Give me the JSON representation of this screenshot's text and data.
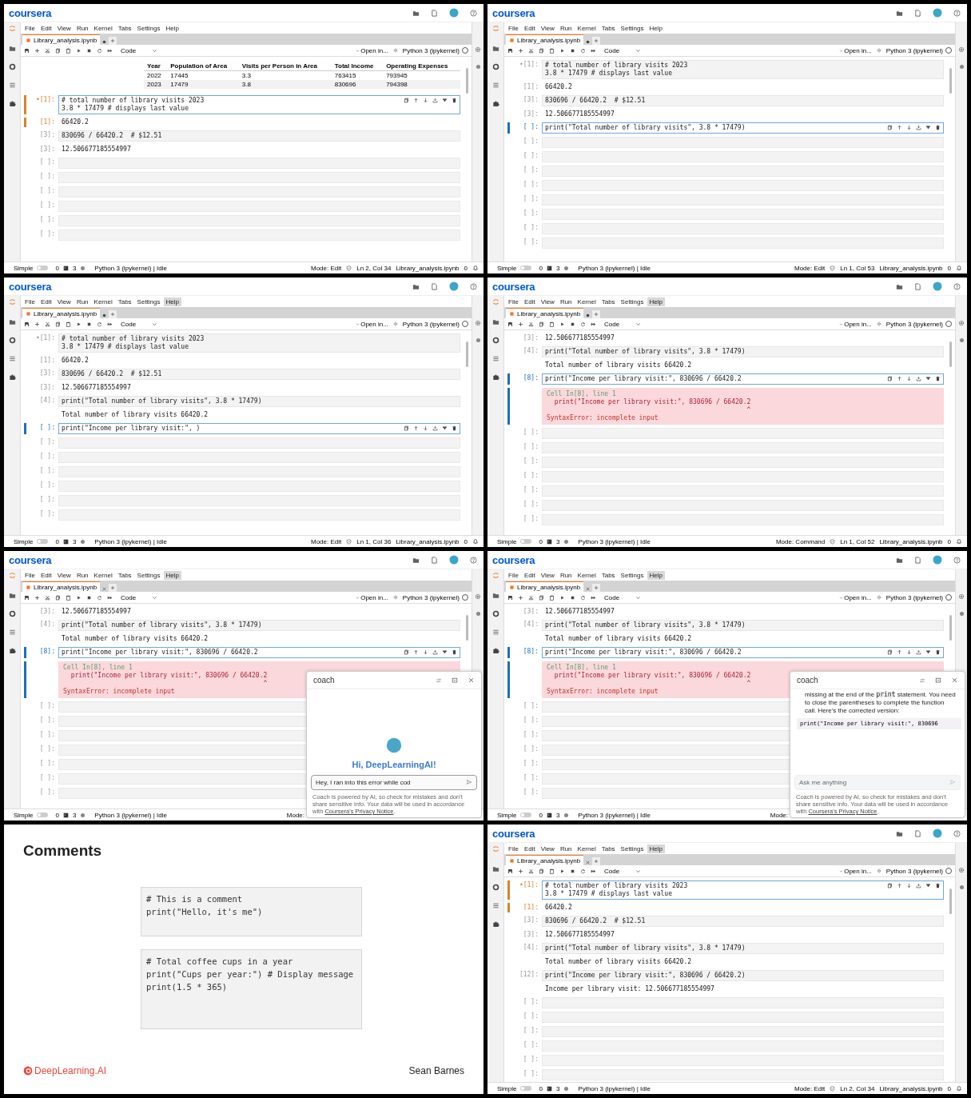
{
  "panels": [
    {
      "kind": "notebook",
      "brand": "coursera",
      "menu": [
        {
          "label": "File",
          "selected": false
        },
        {
          "label": "Edit",
          "selected": false
        },
        {
          "label": "View",
          "selected": false
        },
        {
          "label": "Run",
          "selected": false
        },
        {
          "label": "Kernel",
          "selected": false
        },
        {
          "label": "Tabs",
          "selected": false
        },
        {
          "label": "Settings",
          "selected": false
        },
        {
          "label": "Help",
          "selected": false
        }
      ],
      "tab": {
        "title": "Library_analysis.ipynb",
        "modified": true
      },
      "toolbar": {
        "cell_type": "Code",
        "open_in": "Open in...",
        "kernel": "Python 3 (ipykernel)"
      },
      "cells": [
        {
          "kind": "table",
          "selected": false,
          "columns": [
            "Year",
            "Population of Area",
            "Visits per Person in Area",
            "Total Income",
            "Operating Expenses"
          ],
          "rows": [
            [
              "2022",
              "17445",
              "3.3",
              "763415",
              "793945"
            ],
            [
              "2023",
              "17479",
              "3.8",
              "830696",
              "794398"
            ]
          ]
        },
        {
          "kind": "code",
          "prompt": "•[1]:",
          "text": "# total number of library visits 2023\n3.8 * 17479 # displays last value",
          "selected": true,
          "color": "#d9822b"
        },
        {
          "kind": "output",
          "prompt": "[1]:",
          "text": "66420.2",
          "selected": false,
          "color": "#d9822b"
        },
        {
          "kind": "code",
          "prompt": "[3]:",
          "text": "830696 / 66420.2  # $12.51",
          "selected": false
        },
        {
          "kind": "output",
          "prompt": "[3]:",
          "text": "12.506677185554997",
          "selected": false
        },
        {
          "kind": "empty",
          "prompt": "[ ]:",
          "selected": false
        },
        {
          "kind": "empty",
          "prompt": "[ ]:",
          "selected": false
        },
        {
          "kind": "empty",
          "prompt": "[ ]:",
          "selected": false
        },
        {
          "kind": "empty",
          "prompt": "[ ]:",
          "selected": false
        },
        {
          "kind": "empty",
          "prompt": "[ ]:",
          "selected": false
        },
        {
          "kind": "empty",
          "prompt": "[ ]:",
          "selected": false
        }
      ],
      "status": {
        "toggle": "Simple",
        "toggle_on": false,
        "terminals": "0",
        "kernels": "3",
        "kernel_status": "Python 3 (ipykernel) | Idle",
        "mode": "Mode: Edit",
        "position": "Ln 2, Col 34",
        "file": "Library_analysis.ipynb",
        "notifications": "0"
      }
    },
    {
      "kind": "notebook",
      "brand": "coursera",
      "menu": [
        {
          "label": "File",
          "selected": false
        },
        {
          "label": "Edit",
          "selected": false
        },
        {
          "label": "View",
          "selected": false
        },
        {
          "label": "Run",
          "selected": false
        },
        {
          "label": "Kernel",
          "selected": false
        },
        {
          "label": "Tabs",
          "selected": false
        },
        {
          "label": "Settings",
          "selected": false
        },
        {
          "label": "Help",
          "selected": false
        }
      ],
      "tab": {
        "title": "Library_analysis.ipynb",
        "modified": true
      },
      "toolbar": {
        "cell_type": "Code",
        "open_in": "Open in...",
        "kernel": "Python 3 (ipykernel)"
      },
      "cells": [
        {
          "kind": "code",
          "prompt": "•[1]:",
          "text": "# total number of library visits 2023\n3.8 * 17479 # displays last value",
          "selected": false
        },
        {
          "kind": "output",
          "prompt": "[1]:",
          "text": "66420.2",
          "selected": false
        },
        {
          "kind": "code",
          "prompt": "[3]:",
          "text": "830696 / 66420.2  # $12.51",
          "selected": false
        },
        {
          "kind": "output",
          "prompt": "[3]:",
          "text": "12.506677185554997",
          "selected": false
        },
        {
          "kind": "code",
          "prompt": "[ ]:",
          "text": "print(\"Total number of library visits\", 3.8 * 17479)",
          "selected": true,
          "color": "#1f6fb5"
        },
        {
          "kind": "empty",
          "prompt": "[ ]:",
          "selected": false
        },
        {
          "kind": "empty",
          "prompt": "[ ]:",
          "selected": false
        },
        {
          "kind": "empty",
          "prompt": "[ ]:",
          "selected": false
        },
        {
          "kind": "empty",
          "prompt": "[ ]:",
          "selected": false
        },
        {
          "kind": "empty",
          "prompt": "[ ]:",
          "selected": false
        },
        {
          "kind": "empty",
          "prompt": "[ ]:",
          "selected": false
        },
        {
          "kind": "empty",
          "prompt": "[ ]:",
          "selected": false
        },
        {
          "kind": "empty",
          "prompt": "[ ]:",
          "selected": false
        }
      ],
      "status": {
        "toggle": "Simple",
        "toggle_on": false,
        "terminals": "0",
        "kernels": "3",
        "kernel_status": "Python 3 (ipykernel) | Idle",
        "mode": "Mode: Edit",
        "position": "Ln 1, Col 53",
        "file": "Library_analysis.ipynb",
        "notifications": "0"
      }
    },
    {
      "kind": "notebook",
      "brand": "coursera",
      "menu": [
        {
          "label": "File",
          "selected": false
        },
        {
          "label": "Edit",
          "selected": false
        },
        {
          "label": "View",
          "selected": false
        },
        {
          "label": "Run",
          "selected": false
        },
        {
          "label": "Kernel",
          "selected": false
        },
        {
          "label": "Tabs",
          "selected": false
        },
        {
          "label": "Settings",
          "selected": false
        },
        {
          "label": "Help",
          "selected": true
        }
      ],
      "tab": {
        "title": "Library_analysis.ipynb",
        "modified": true
      },
      "toolbar": {
        "cell_type": "Code",
        "open_in": "Open in...",
        "kernel": "Python 3 (ipykernel)"
      },
      "cells": [
        {
          "kind": "code",
          "prompt": "•[1]:",
          "text": "# total number of library visits 2023\n3.8 * 17479 # displays last value",
          "selected": false
        },
        {
          "kind": "output",
          "prompt": "[1]:",
          "text": "66420.2",
          "selected": false
        },
        {
          "kind": "code",
          "prompt": "[3]:",
          "text": "830696 / 66420.2  # $12.51",
          "selected": false
        },
        {
          "kind": "output",
          "prompt": "[3]:",
          "text": "12.506677185554997",
          "selected": false
        },
        {
          "kind": "code",
          "prompt": "[4]:",
          "text": "print(\"Total number of library visits\", 3.8 * 17479)",
          "selected": false
        },
        {
          "kind": "output",
          "text": "Total number of library visits 66420.2",
          "selected": false
        },
        {
          "kind": "code",
          "prompt": "[ ]:",
          "text": "print(\"Income per library visit:\", )",
          "selected": true,
          "color": "#1f6fb5"
        },
        {
          "kind": "empty",
          "prompt": "[ ]:",
          "selected": false
        },
        {
          "kind": "empty",
          "prompt": "[ ]:",
          "selected": false
        },
        {
          "kind": "empty",
          "prompt": "[ ]:",
          "selected": false
        },
        {
          "kind": "empty",
          "prompt": "[ ]:",
          "selected": false
        },
        {
          "kind": "empty",
          "prompt": "[ ]:",
          "selected": false
        },
        {
          "kind": "empty",
          "prompt": "[ ]:",
          "selected": false
        }
      ],
      "status": {
        "toggle": "Simple",
        "toggle_on": false,
        "terminals": "0",
        "kernels": "3",
        "kernel_status": "Python 3 (ipykernel) | Idle",
        "mode": "Mode: Edit",
        "position": "Ln 1, Col 36",
        "file": "Library_analysis.ipynb",
        "notifications": "0"
      }
    },
    {
      "kind": "notebook",
      "brand": "coursera",
      "menu": [
        {
          "label": "File",
          "selected": false
        },
        {
          "label": "Edit",
          "selected": false
        },
        {
          "label": "View",
          "selected": false
        },
        {
          "label": "Run",
          "selected": false
        },
        {
          "label": "Kernel",
          "selected": false
        },
        {
          "label": "Tabs",
          "selected": false
        },
        {
          "label": "Settings",
          "selected": false
        },
        {
          "label": "Help",
          "selected": true
        }
      ],
      "tab": {
        "title": "Library_analysis.ipynb",
        "modified": true
      },
      "toolbar": {
        "cell_type": "Code",
        "open_in": "Open in...",
        "kernel": "Python 3 (ipykernel)"
      },
      "cells": [
        {
          "kind": "output",
          "prompt": "[3]:",
          "text": "12.506677185554997",
          "selected": false
        },
        {
          "kind": "code",
          "prompt": "[4]:",
          "text": "print(\"Total number of library visits\", 3.8 * 17479)",
          "selected": false
        },
        {
          "kind": "output",
          "text": "Total number of library visits 66420.2",
          "selected": false
        },
        {
          "kind": "code",
          "prompt": "[8]:",
          "text": "print(\"Income per library visit:\", 830696 / 66420.2",
          "selected": true,
          "color": "#1f6fb5"
        },
        {
          "kind": "error",
          "selected": false,
          "color": "#1f6fb5",
          "lines": [
            {
              "kind": "location",
              "text": "Cell In[8], line 1"
            },
            {
              "kind": "source",
              "text": "  print(\"Income per library visit:\", 830696 / 66420.2"
            },
            {
              "kind": "caret",
              "text": "                                                    ^"
            },
            {
              "kind": "message",
              "text": "SyntaxError: incomplete input"
            }
          ]
        },
        {
          "kind": "empty",
          "prompt": "[ ]:",
          "selected": false
        },
        {
          "kind": "empty",
          "prompt": "[ ]:",
          "selected": false
        },
        {
          "kind": "empty",
          "prompt": "[ ]:",
          "selected": false
        },
        {
          "kind": "empty",
          "prompt": "[ ]:",
          "selected": false
        },
        {
          "kind": "empty",
          "prompt": "[ ]:",
          "selected": false
        },
        {
          "kind": "empty",
          "prompt": "[ ]:",
          "selected": false
        },
        {
          "kind": "empty",
          "prompt": "[ ]:",
          "selected": false
        }
      ],
      "status": {
        "toggle": "Simple",
        "toggle_on": false,
        "terminals": "0",
        "kernels": "3",
        "kernel_status": "Python 3 (ipykernel) | Idle",
        "mode": "Mode: Command",
        "position": "Ln 1, Col 52",
        "file": "Library_analysis.ipynb",
        "notifications": "0"
      }
    },
    {
      "kind": "notebook",
      "brand": "coursera",
      "menu": [
        {
          "label": "File",
          "selected": false
        },
        {
          "label": "Edit",
          "selected": false
        },
        {
          "label": "View",
          "selected": false
        },
        {
          "label": "Run",
          "selected": false
        },
        {
          "label": "Kernel",
          "selected": false
        },
        {
          "label": "Tabs",
          "selected": false
        },
        {
          "label": "Settings",
          "selected": false
        },
        {
          "label": "Help",
          "selected": true
        }
      ],
      "tab": {
        "title": "Library_analysis.ipynb",
        "modified": false
      },
      "toolbar": {
        "cell_type": "Code",
        "open_in": "Open in...",
        "kernel": "Python 3 (ipykernel)"
      },
      "cells": [
        {
          "kind": "output",
          "prompt": "[3]:",
          "text": "12.506677185554997",
          "selected": false
        },
        {
          "kind": "code",
          "prompt": "[4]:",
          "text": "print(\"Total number of library visits\", 3.8 * 17479)",
          "selected": false
        },
        {
          "kind": "output",
          "text": "Total number of library visits 66420.2",
          "selected": false
        },
        {
          "kind": "code",
          "prompt": "[8]:",
          "text": "print(\"Income per library visit:\", 830696 / 66420.2",
          "selected": true,
          "color": "#1f6fb5"
        },
        {
          "kind": "error",
          "selected": false,
          "color": "#1f6fb5",
          "lines": [
            {
              "kind": "location",
              "text": "Cell In[8], line 1"
            },
            {
              "kind": "source",
              "text": "  print(\"Income per library visit:\", 830696 / 66420.2"
            },
            {
              "kind": "caret",
              "text": "                                                    ^"
            },
            {
              "kind": "message",
              "text": "SyntaxError: incomplete input"
            }
          ]
        },
        {
          "kind": "empty",
          "prompt": "[ ]:",
          "selected": false
        },
        {
          "kind": "empty",
          "prompt": "[ ]:",
          "selected": false
        },
        {
          "kind": "empty",
          "prompt": "[ ]:",
          "selected": false
        },
        {
          "kind": "empty",
          "prompt": "[ ]:",
          "selected": false
        },
        {
          "kind": "empty",
          "prompt": "[ ]:",
          "selected": false
        },
        {
          "kind": "empty",
          "prompt": "[ ]:",
          "selected": false
        },
        {
          "kind": "empty",
          "prompt": "[ ]:",
          "selected": false
        }
      ],
      "status": {
        "toggle": "Simple",
        "toggle_on": false,
        "terminals": "0",
        "kernels": "3",
        "kernel_status": "Python 3 (ipykernel) | Idle",
        "mode": "Mode:"
      },
      "coach": {
        "kind": "greeting",
        "title": "coach",
        "greeting": "Hi, DeepLearningAI!",
        "input": "Hey, I ran into this error while cod",
        "footer": "Coach is powered by AI, so check for mistakes and don't share sensitive info. Your data will be used in accordance with",
        "link": "Coursera's Privacy Notice",
        "footer_end": "."
      }
    },
    {
      "kind": "notebook",
      "brand": "coursera",
      "menu": [
        {
          "label": "File",
          "selected": false
        },
        {
          "label": "Edit",
          "selected": false
        },
        {
          "label": "View",
          "selected": false
        },
        {
          "label": "Run",
          "selected": false
        },
        {
          "label": "Kernel",
          "selected": false
        },
        {
          "label": "Tabs",
          "selected": false
        },
        {
          "label": "Settings",
          "selected": false
        },
        {
          "label": "Help",
          "selected": true
        }
      ],
      "tab": {
        "title": "Library_analysis.ipynb",
        "modified": false
      },
      "toolbar": {
        "cell_type": "Code",
        "open_in": "Open in...",
        "kernel": "Python 3 (ipykernel)"
      },
      "cells": [
        {
          "kind": "output",
          "prompt": "[3]:",
          "text": "12.506677185554997",
          "selected": false
        },
        {
          "kind": "code",
          "prompt": "[4]:",
          "text": "print(\"Total number of library visits\", 3.8 * 17479)",
          "selected": false
        },
        {
          "kind": "output",
          "text": "Total number of library visits 66420.2",
          "selected": false
        },
        {
          "kind": "code",
          "prompt": "[8]:",
          "text": "print(\"Income per library visit:\", 830696 / 66420.2",
          "selected": true,
          "color": "#1f6fb5"
        },
        {
          "kind": "error",
          "selected": false,
          "color": "#1f6fb5",
          "lines": [
            {
              "kind": "location",
              "text": "Cell In[8], line 1"
            },
            {
              "kind": "source",
              "text": "  print(\"Income per library visit:\", 830696 / 66420.2"
            },
            {
              "kind": "caret",
              "text": "                                                    ^"
            },
            {
              "kind": "message",
              "text": "SyntaxError: incomplete input"
            }
          ]
        },
        {
          "kind": "empty",
          "prompt": "[ ]:",
          "selected": false
        },
        {
          "kind": "empty",
          "prompt": "[ ]:",
          "selected": false
        },
        {
          "kind": "empty",
          "prompt": "[ ]:",
          "selected": false
        },
        {
          "kind": "empty",
          "prompt": "[ ]:",
          "selected": false
        },
        {
          "kind": "empty",
          "prompt": "[ ]:",
          "selected": false
        },
        {
          "kind": "empty",
          "prompt": "[ ]:",
          "selected": false
        },
        {
          "kind": "empty",
          "prompt": "[ ]:",
          "selected": false
        }
      ],
      "status": {
        "toggle": "Simple",
        "toggle_on": false,
        "terminals": "0",
        "kernels": "3",
        "kernel_status": "Python 3 (ipykernel) | Idle",
        "mode": "Mode:"
      },
      "coach": {
        "kind": "chat",
        "title": "coach",
        "message_before": "missing at the end of the ",
        "message_code": "print",
        "message_after": " statement. You need to close the parentheses to complete the function call. Here's the corrected version:",
        "code": "print(\"Income per library visit:\", 830696",
        "placeholder": "Ask me anything",
        "footer": "Coach is powered by AI, so check for mistakes and don't share sensitive info. Your data will be used in accordance with",
        "link": "Coursera's Privacy Notice",
        "footer_end": "."
      }
    },
    {
      "kind": "slide",
      "title": "Comments",
      "code_blocks": [
        "# This is a comment\nprint(\"Hello, it's me\")",
        "# Total coffee cups in a year\nprint(\"Cups per year:\") # Display message\nprint(1.5 * 365)"
      ],
      "logo": "DeepLearning.AI",
      "presenter": "Sean Barnes"
    },
    {
      "kind": "notebook",
      "brand": "coursera",
      "menu": [
        {
          "label": "File",
          "selected": false
        },
        {
          "label": "Edit",
          "selected": false
        },
        {
          "label": "View",
          "selected": false
        },
        {
          "label": "Run",
          "selected": false
        },
        {
          "label": "Kernel",
          "selected": false
        },
        {
          "label": "Tabs",
          "selected": false
        },
        {
          "label": "Settings",
          "selected": false
        },
        {
          "label": "Help",
          "selected": true
        }
      ],
      "tab": {
        "title": "Library_analysis.ipynb",
        "modified": false
      },
      "toolbar": {
        "cell_type": "Code",
        "open_in": "Open in...",
        "kernel": "Python 3 (ipykernel)"
      },
      "cells": [
        {
          "kind": "code",
          "prompt": "•[1]:",
          "text": "# total number of library visits 2023\n3.8 * 17479 # displays last value",
          "selected": true,
          "color": "#d9822b"
        },
        {
          "kind": "output",
          "prompt": "[1]:",
          "text": "66420.2",
          "selected": false,
          "color": "#d9822b"
        },
        {
          "kind": "code",
          "prompt": "[3]:",
          "text": "830696 / 66420.2  # $12.51",
          "selected": false
        },
        {
          "kind": "output",
          "prompt": "[3]:",
          "text": "12.506677185554997",
          "selected": false
        },
        {
          "kind": "code",
          "prompt": "[4]:",
          "text": "print(\"Total number of library visits\", 3.8 * 17479)",
          "selected": false
        },
        {
          "kind": "output",
          "text": "Total number of library visits 66420.2",
          "selected": false
        },
        {
          "kind": "code",
          "prompt": "[12]:",
          "text": "print(\"Income per library visit:\", 830696 / 66420.2)",
          "selected": false
        },
        {
          "kind": "output",
          "text": "Income per library visit: 12.506677185554997",
          "selected": false
        },
        {
          "kind": "empty",
          "prompt": "[ ]:",
          "selected": false
        },
        {
          "kind": "empty",
          "prompt": "[ ]:",
          "selected": false
        },
        {
          "kind": "empty",
          "prompt": "[ ]:",
          "selected": false
        },
        {
          "kind": "empty",
          "prompt": "[ ]:",
          "selected": false
        },
        {
          "kind": "empty",
          "prompt": "[ ]:",
          "selected": false
        },
        {
          "kind": "empty",
          "prompt": "[ ]:",
          "selected": false
        }
      ],
      "status": {
        "toggle": "Simple",
        "toggle_on": false,
        "terminals": "0",
        "kernels": "3",
        "kernel_status": "Python 3 (ipykernel) | Idle",
        "mode": "Mode: Edit",
        "position": "Ln 2, Col 34",
        "file": "Library_analysis.ipynb",
        "notifications": "0"
      }
    }
  ]
}
